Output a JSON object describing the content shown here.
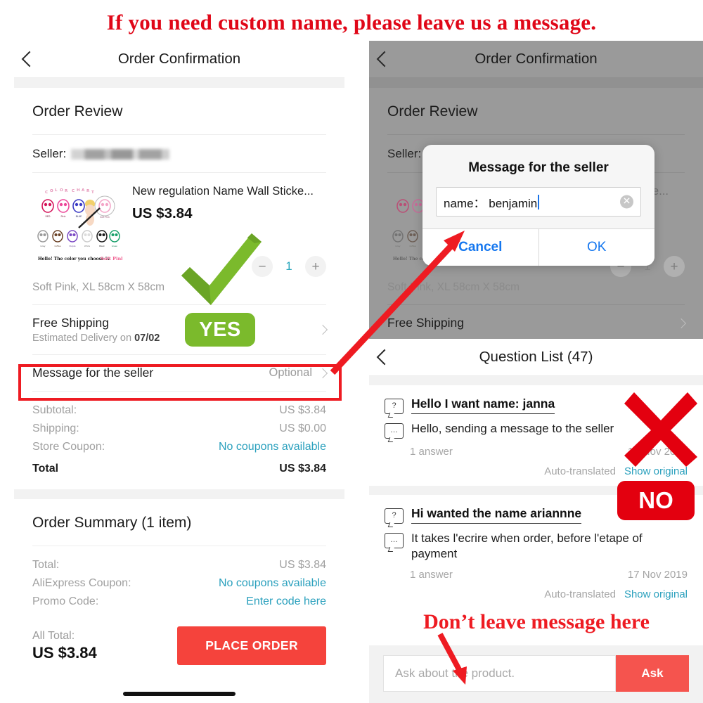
{
  "banner": {
    "text": "If you need custom name, please leave us a message."
  },
  "annotations": {
    "yes_badge": "YES",
    "no_badge": "NO",
    "bottom_note": "Don’t leave  message here",
    "accent_red": "#ee1b22",
    "accent_green": "#7bba2c",
    "brand_red": "#f5433c",
    "link_blue": "#1577ef",
    "link_teal": "#2aa0bd"
  },
  "left_phone": {
    "navbar": {
      "title": "Order Confirmation",
      "back_icon": "chevron-left-icon"
    },
    "order_review": {
      "heading": "Order Review",
      "seller_label": "Seller:",
      "seller_value": ""
    },
    "product": {
      "title": "New regulation Name Wall Sticke...",
      "price": "US $3.84",
      "variant": "Soft Pink, XL 58cm X 58cm",
      "qty": "1",
      "minus_icon": "minus-icon",
      "plus_icon": "plus-icon",
      "thumb_caption": "Hello! The color you choose is Soft Pink",
      "thumb_heading": "COLOR CHART",
      "thumb_colors_row1": [
        "RED",
        "Pink",
        "BLUE",
        "Soft Pink"
      ],
      "thumb_colors_row2": [
        "Gray",
        "Coffee",
        "Purple",
        "White",
        "Black",
        "Green"
      ]
    },
    "shipping": {
      "title": "Free Shipping",
      "subtitle_prefix": "Estimated Delivery on ",
      "subtitle_date": "07/02",
      "chevron_icon": "chevron-right-icon"
    },
    "message_row": {
      "label": "Message for the seller",
      "value": "Optional",
      "chevron_icon": "chevron-right-icon"
    },
    "price_breakdown": [
      {
        "label": "Subtotal:",
        "value": "US $3.84",
        "link": false,
        "total": false
      },
      {
        "label": "Shipping:",
        "value": "US $0.00",
        "link": false,
        "total": false
      },
      {
        "label": "Store Coupon:",
        "value": "No coupons available",
        "link": true,
        "total": false
      },
      {
        "label": "Total",
        "value": "US $3.84",
        "link": false,
        "total": true
      }
    ],
    "order_summary": {
      "heading": "Order Summary (1 item)",
      "rows": [
        {
          "label": "Total:",
          "value": "US $3.84",
          "link": false
        },
        {
          "label": "AliExpress Coupon:",
          "value": "No coupons available",
          "link": true
        },
        {
          "label": "Promo Code:",
          "value": "Enter code here",
          "link": true
        }
      ],
      "all_total_label": "All Total:",
      "all_total_value": "US $3.84",
      "place_order_button": "PLACE ORDER"
    }
  },
  "right_phone": {
    "navbar": {
      "title": "Order Confirmation",
      "back_icon": "chevron-left-icon"
    },
    "order_review": {
      "heading": "Order Review",
      "seller_label": "Seller:"
    },
    "product": {
      "title": "New regulation Name Wall Sticke...",
      "variant": "Soft Pink, XL 58cm X 58cm",
      "qty": "1",
      "minus_icon": "minus-icon",
      "plus_icon": "plus-icon"
    },
    "shipping": {
      "title": "Free Shipping",
      "chevron_icon": "chevron-right-icon"
    },
    "dialog": {
      "title": "Message for the seller",
      "input_value": "name： benjamin",
      "clear_icon": "clear-circle-icon",
      "cancel_label": "Cancel",
      "ok_label": "OK"
    },
    "question_list": {
      "navbar": {
        "title": "Question List (47)",
        "back_icon": "chevron-left-icon"
      },
      "items": [
        {
          "question_icon": "question-bubble-icon",
          "question": "Hello I want name: janna",
          "answer_icon": "answer-bubble-icon",
          "answer": "Hello, sending a message to the seller",
          "answer_count": "1 answer",
          "date": "17 Nov 2019",
          "translated_label": "Auto-translated",
          "show_original_label": "Show original"
        },
        {
          "question_icon": "question-bubble-icon",
          "question": "Hi wanted the name ariannne",
          "answer_icon": "answer-bubble-icon",
          "answer": "It takes l'ecrire when order, before l'etape of payment",
          "answer_count": "1 answer",
          "date": "17 Nov 2019",
          "translated_label": "Auto-translated",
          "show_original_label": "Show original"
        }
      ],
      "ask_placeholder": "Ask about the product.",
      "ask_button": "Ask"
    }
  }
}
